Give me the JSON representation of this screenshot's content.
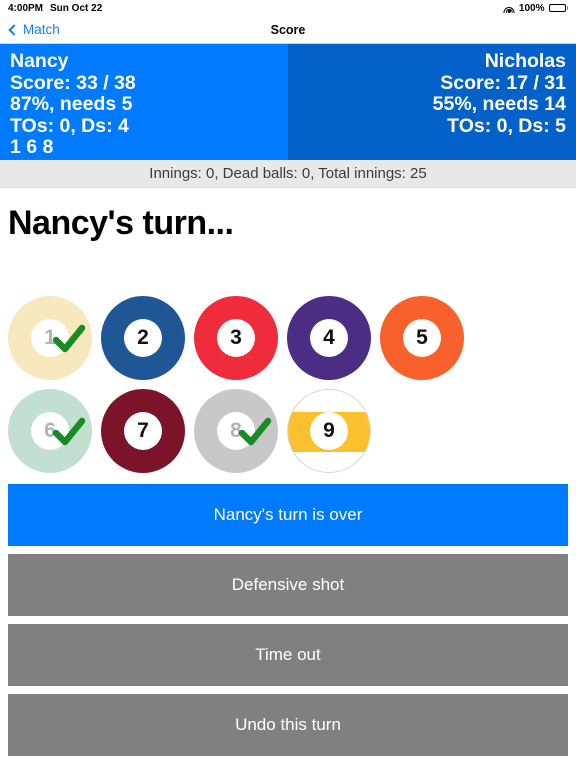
{
  "status_bar": {
    "time": "4:00PM",
    "date": "Sun Oct 22",
    "battery_percent": "100%",
    "wifi_icon": "wifi-icon",
    "battery_icon": "battery-icon"
  },
  "nav": {
    "back_label": "Match",
    "back_icon": "chevron-left-icon",
    "title": "Score"
  },
  "players": {
    "left": {
      "name": "Nancy",
      "score": "Score: 33 / 38",
      "percent_needs": "87%, needs 5",
      "tos_ds": "TOs: 0, Ds: 4",
      "run": "1 6 8",
      "color": "#007aff"
    },
    "right": {
      "name": "Nicholas",
      "score": "Score: 17 / 31",
      "percent_needs": "55%, needs 14",
      "tos_ds": "TOs: 0, Ds: 5",
      "color": "#0561ca"
    }
  },
  "innings_bar": "Innings: 0, Dead balls: 0, Total innings: 25",
  "turn_title": "Nancy's turn...",
  "balls": [
    {
      "number": "1",
      "color": "#f8e8bd",
      "pocketed": true,
      "striped": false
    },
    {
      "number": "2",
      "color": "#1f5796",
      "pocketed": false,
      "striped": false
    },
    {
      "number": "3",
      "color": "#ef2b3c",
      "pocketed": false,
      "striped": false
    },
    {
      "number": "4",
      "color": "#4b2e83",
      "pocketed": false,
      "striped": false
    },
    {
      "number": "5",
      "color": "#f8612b",
      "pocketed": false,
      "striped": false
    },
    {
      "number": "6",
      "color": "#c1e0d2",
      "pocketed": true,
      "striped": false
    },
    {
      "number": "7",
      "color": "#7b1428",
      "pocketed": false,
      "striped": false
    },
    {
      "number": "8",
      "color": "#c8c8c8",
      "pocketed": true,
      "striped": false
    },
    {
      "number": "9",
      "color": "#fbc02d",
      "pocketed": false,
      "striped": true
    }
  ],
  "check_icon": "check-icon",
  "check_color": "#1a8b22",
  "actions": [
    {
      "label": "Nancy's turn is over",
      "style": "primary",
      "name": "turn-over-button"
    },
    {
      "label": "Defensive shot",
      "style": "secondary",
      "name": "defensive-shot-button"
    },
    {
      "label": "Time out",
      "style": "secondary",
      "name": "time-out-button"
    },
    {
      "label": "Undo this turn",
      "style": "secondary",
      "name": "undo-turn-button"
    }
  ]
}
